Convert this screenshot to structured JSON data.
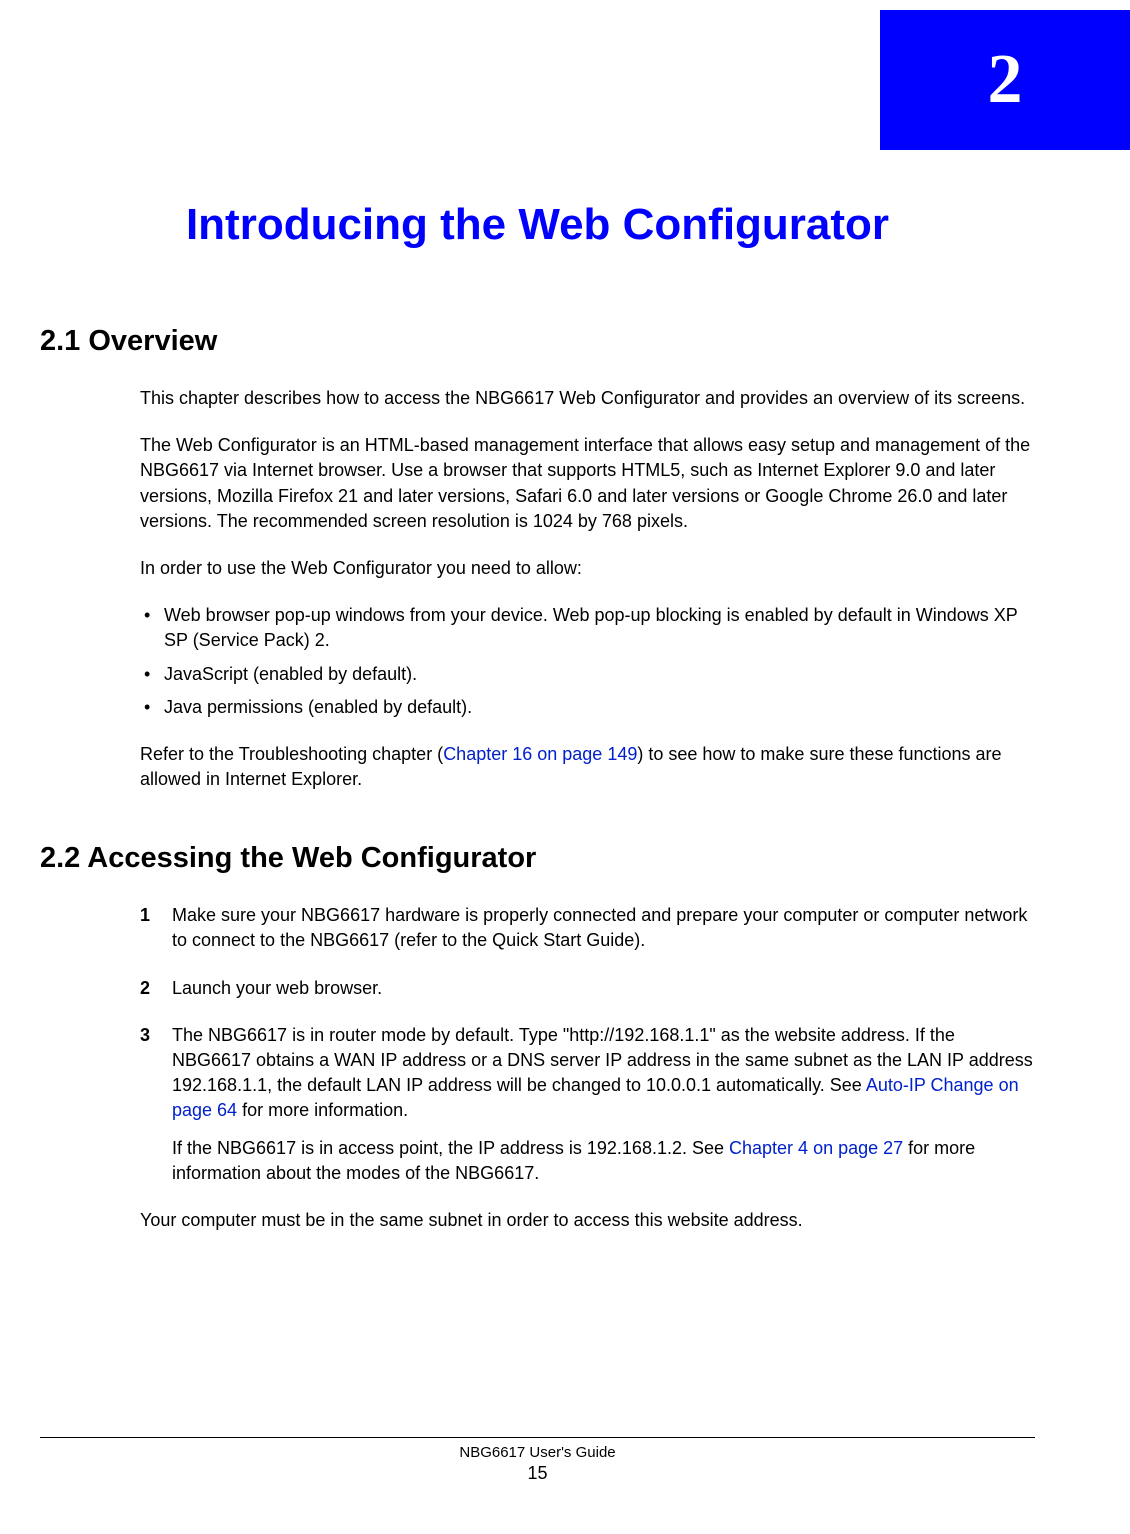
{
  "chapter": {
    "number": "2",
    "title": "Introducing the Web Configurator"
  },
  "section1": {
    "heading": "2.1  Overview",
    "p1": "This chapter describes how to access the NBG6617 Web Configurator and provides an overview of its screens.",
    "p2": "The Web Configurator is an HTML-based management interface that allows easy setup and management of the NBG6617 via Internet browser. Use a browser that supports HTML5, such as Internet Explorer 9.0 and later versions, Mozilla Firefox 21 and later versions, Safari 6.0 and later versions or Google Chrome 26.0 and later versions. The recommended screen resolution is 1024 by 768 pixels.",
    "p3": "In order to use the Web Configurator you need to allow:",
    "bullets": [
      "Web browser pop-up windows from your device. Web pop-up blocking is enabled by default in Windows XP SP (Service Pack) 2.",
      "JavaScript (enabled by default).",
      "Java permissions (enabled by default)."
    ],
    "p4a": "Refer to the Troubleshooting chapter (",
    "p4_link": "Chapter 16 on page 149",
    "p4b": ") to see how to make sure these functions are allowed in Internet Explorer."
  },
  "section2": {
    "heading": "2.2  Accessing the Web Configurator",
    "steps": [
      {
        "num": "1",
        "text": "Make sure your NBG6617 hardware is properly connected and prepare your computer or computer network to connect to the NBG6617 (refer to the Quick Start Guide)."
      },
      {
        "num": "2",
        "text": "Launch your web browser."
      },
      {
        "num": "3",
        "text_a": "The NBG6617 is in router mode by default. Type \"http://192.168.1.1\" as the website address. If the NBG6617 obtains a WAN IP address or a DNS server IP address in the same subnet as the LAN IP address 192.168.1.1, the default LAN IP address will be changed to 10.0.0.1 automatically. See ",
        "link1": "Auto-IP Change on page 64",
        "text_b": " for more information.",
        "sub_a": "If the NBG6617 is in access point, the IP address is 192.168.1.2. See ",
        "link2": "Chapter 4 on page 27",
        "sub_b": " for more information about the modes of the NBG6617."
      }
    ],
    "closing": "Your computer must be in the same subnet in order to access this website address."
  },
  "footer": {
    "title": "NBG6617 User's Guide",
    "page": "15"
  }
}
